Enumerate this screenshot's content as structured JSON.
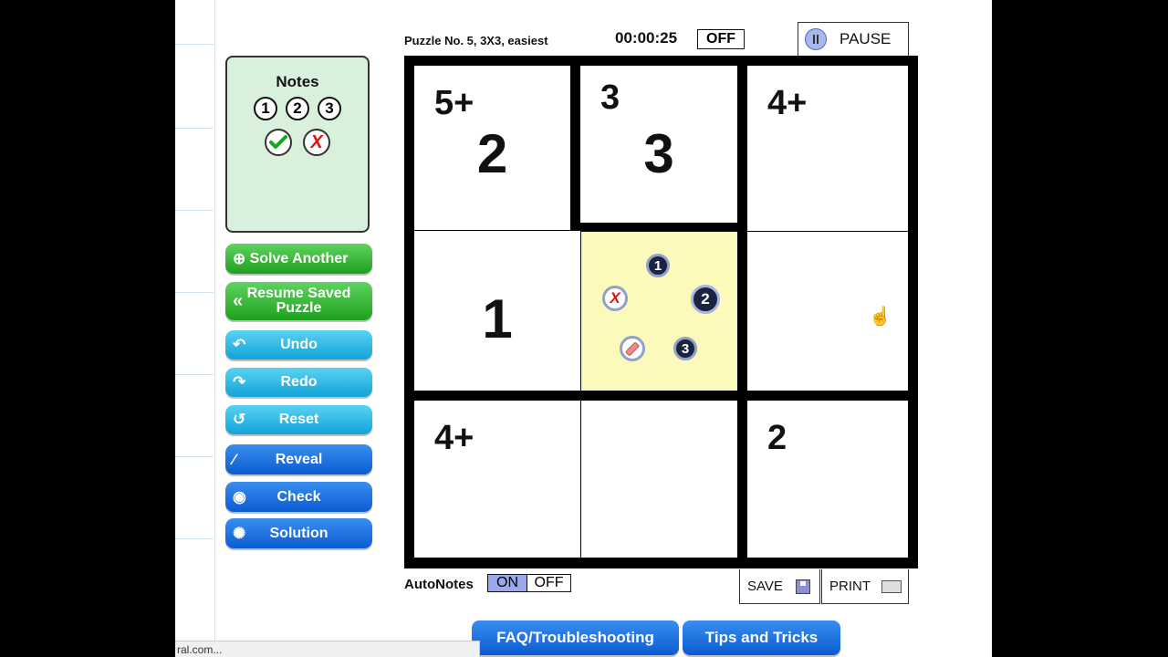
{
  "puzzle": {
    "info": "Puzzle No. 5, 3X3, easiest",
    "timer": "00:00:25",
    "timer_toggle": "OFF",
    "pause_label": "PAUSE"
  },
  "notes_panel": {
    "title": "Notes",
    "numbers": [
      "1",
      "2",
      "3"
    ],
    "confirm_icon": "checkmark-icon",
    "clear_symbol": "X"
  },
  "side_buttons": {
    "solve_another": "Solve Another",
    "resume_line1": "Resume Saved",
    "resume_line2": "Puzzle",
    "undo": "Undo",
    "redo": "Redo",
    "reset": "Reset",
    "reveal": "Reveal",
    "check": "Check",
    "solution": "Solution"
  },
  "grid": {
    "size": "3x3",
    "cells": [
      {
        "cage": "5+",
        "value": "2"
      },
      {
        "cage": "3",
        "value": "3"
      },
      {
        "cage": "4+",
        "value": ""
      },
      {
        "cage": "",
        "value": "1"
      },
      {
        "cage": "",
        "value": "",
        "selected": true
      },
      {
        "cage": "",
        "value": ""
      },
      {
        "cage": "4+",
        "value": ""
      },
      {
        "cage": "",
        "value": ""
      },
      {
        "cage": "2",
        "value": ""
      }
    ],
    "picker": {
      "one": "1",
      "two": "2",
      "three": "3",
      "clear": "X"
    }
  },
  "autonotes": {
    "label": "AutoNotes",
    "on": "ON",
    "off": "OFF"
  },
  "save_label": "SAVE",
  "print_label": "PRINT",
  "bottom": {
    "faq": "FAQ/Troubleshooting",
    "tips": "Tips and Tricks"
  },
  "status_text": "ral.com...",
  "colors": {
    "selected_cell": "#fbfabb",
    "notes_bg": "#d8f0dc",
    "green_button": "#2ab52a",
    "cyan_button": "#1eb0e0",
    "blue_button": "#1a6fe0"
  }
}
